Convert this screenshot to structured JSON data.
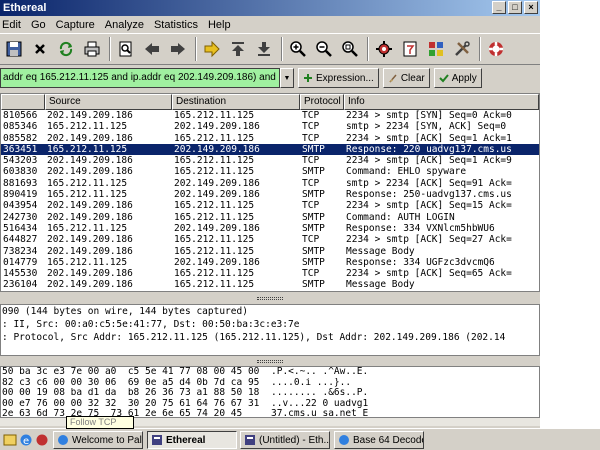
{
  "window": {
    "title": "Ethereal"
  },
  "menu": [
    "Edit",
    "Go",
    "Capture",
    "Analyze",
    "Statistics",
    "Help"
  ],
  "filter": {
    "value": "addr eq 165.212.11.125 and ip.addr eq 202.149.209.186) and (tcp.port e",
    "expression_label": "Expression...",
    "clear_label": "Clear",
    "apply_label": "Apply"
  },
  "packet_list": {
    "columns": [
      "",
      "Source",
      "Destination",
      "Protocol",
      "Info"
    ],
    "rows": [
      [
        "810566",
        "202.149.209.186",
        "165.212.11.125",
        "TCP",
        "2234 > smtp [SYN] Seq=0 Ack=0"
      ],
      [
        "085346",
        "165.212.11.125",
        "202.149.209.186",
        "TCP",
        "smtp > 2234 [SYN, ACK] Seq=0"
      ],
      [
        "085582",
        "202.149.209.186",
        "165.212.11.125",
        "TCP",
        "2234 > smtp [ACK] Seq=1 Ack=1"
      ],
      [
        "363451",
        "165.212.11.125",
        "202.149.209.186",
        "SMTP",
        "Response: 220 uadvg137.cms.us"
      ],
      [
        "543203",
        "202.149.209.186",
        "165.212.11.125",
        "TCP",
        "2234 > smtp [ACK] Seq=1 Ack=9"
      ],
      [
        "603830",
        "202.149.209.186",
        "165.212.11.125",
        "SMTP",
        "Command: EHLO spyware"
      ],
      [
        "881693",
        "165.212.11.125",
        "202.149.209.186",
        "TCP",
        "smtp > 2234 [ACK] Seq=91 Ack="
      ],
      [
        "890419",
        "165.212.11.125",
        "202.149.209.186",
        "SMTP",
        "Response: 250-uadvg137.cms.us"
      ],
      [
        "043954",
        "202.149.209.186",
        "165.212.11.125",
        "TCP",
        "2234 > smtp [ACK] Seq=15 Ack="
      ],
      [
        "242730",
        "202.149.209.186",
        "165.212.11.125",
        "SMTP",
        "Command: AUTH LOGIN"
      ],
      [
        "516434",
        "165.212.11.125",
        "202.149.209.186",
        "SMTP",
        "Response: 334 VXNlcm5hbWU6"
      ],
      [
        "644827",
        "202.149.209.186",
        "165.212.11.125",
        "TCP",
        "2234 > smtp [ACK] Seq=27 Ack="
      ],
      [
        "738234",
        "202.149.209.186",
        "165.212.11.125",
        "SMTP",
        "Message Body"
      ],
      [
        "014779",
        "165.212.11.125",
        "202.149.209.186",
        "SMTP",
        "Response: 334 UGFzc3dvcmQ6"
      ],
      [
        "145530",
        "202.149.209.186",
        "165.212.11.125",
        "TCP",
        "2234 > smtp [ACK] Seq=65 Ack="
      ],
      [
        "236104",
        "202.149.209.186",
        "165.212.11.125",
        "SMTP",
        "Message Body"
      ]
    ],
    "selected_index": 3
  },
  "detail_pane": [
    "090 (144 bytes on wire, 144 bytes captured)",
    ": II, Src: 00:a0:c5:5e:41:77, Dst: 00:50:ba:3c:e3:7e",
    ": Protocol, Src Addr: 165.212.11.125 (165.212.11.125), Dst Addr: 202.149.209.186 (202.14"
  ],
  "hex_pane": [
    {
      "hex": "50 ba 3c e3 7e 00 a0  c5 5e 41 77 08 00 45 00",
      "ascii": ".P.<.~.. .^Aw..E."
    },
    {
      "hex": "82 c3 c6 00 00 30 06  69 0e a5 d4 0b 7d ca 95",
      "ascii": "....0.i ...}.."
    },
    {
      "hex": "00 00 19 08 ba d1 da  b8 26 36 73 a1 88 50 18",
      "ascii": "........ .&6s..P."
    },
    {
      "hex": "00 e7 76 00 00 32 32  30 20 75 61 64 76 67 31",
      "ascii": "..v...22 0 uadvg1"
    },
    {
      "hex": "2e 63 6d 73 2e 75  73 61 2e 6e 65 74 20 45",
      "ascii": "37.cms.u sa.net E"
    }
  ],
  "tooltip": "Follow TCP",
  "taskbar": {
    "tasks": [
      {
        "label": "Welcome to Pala...",
        "icon": "browser-icon",
        "active": false
      },
      {
        "label": "Ethereal",
        "icon": "ethereal-icon",
        "active": true
      },
      {
        "label": "(Untitled) - Eth...",
        "icon": "ethereal-icon",
        "active": false
      },
      {
        "label": "Base 64 Decoder...",
        "icon": "browser-icon",
        "active": false
      }
    ]
  },
  "colors": {
    "selection": "#0a246a",
    "filter_bg": "#a0f0a0",
    "titlebar": "#0a246a"
  }
}
